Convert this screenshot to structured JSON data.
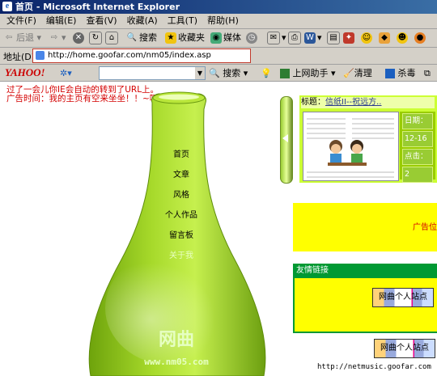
{
  "window": {
    "title": "首页 - Microsoft Internet Explorer"
  },
  "menu": [
    "文件(F)",
    "编辑(E)",
    "查看(V)",
    "收藏(A)",
    "工具(T)",
    "帮助(H)"
  ],
  "toolbar": {
    "back": "后退",
    "search": "搜索",
    "favorites": "收藏夹",
    "media": "媒体"
  },
  "address": {
    "label": "地址(D)",
    "url": "http://home.goofar.com/nm05/index.asp"
  },
  "yahoo": {
    "logo": "YAHOO!",
    "search": "搜索",
    "helper": "上网助手",
    "clean": "清理",
    "kill": "杀毒"
  },
  "notice": {
    "line1": "过了一会儿你IE会自动的转到了URL上。",
    "line2": "广告时间：我的主页有空来坐坐！！~呵呵"
  },
  "nav": [
    "首页",
    "文章",
    "风格",
    "个人作品",
    "留言板",
    "关于我"
  ],
  "bottle": {
    "brand": "网曲",
    "site": "www.nm05.com"
  },
  "post": {
    "title_label": "标题：",
    "title_link": "信纸II--祝远方..",
    "date_label": "日期：",
    "date_value": "12-16",
    "clicks_label": "点击：",
    "clicks_value": "2"
  },
  "ad": {
    "text": "广告位"
  },
  "friends": {
    "header": "友情链接",
    "button1": "网曲个人站点",
    "button2": "网曲个人站点"
  },
  "status_url": "http://netmusic.goofar.com"
}
